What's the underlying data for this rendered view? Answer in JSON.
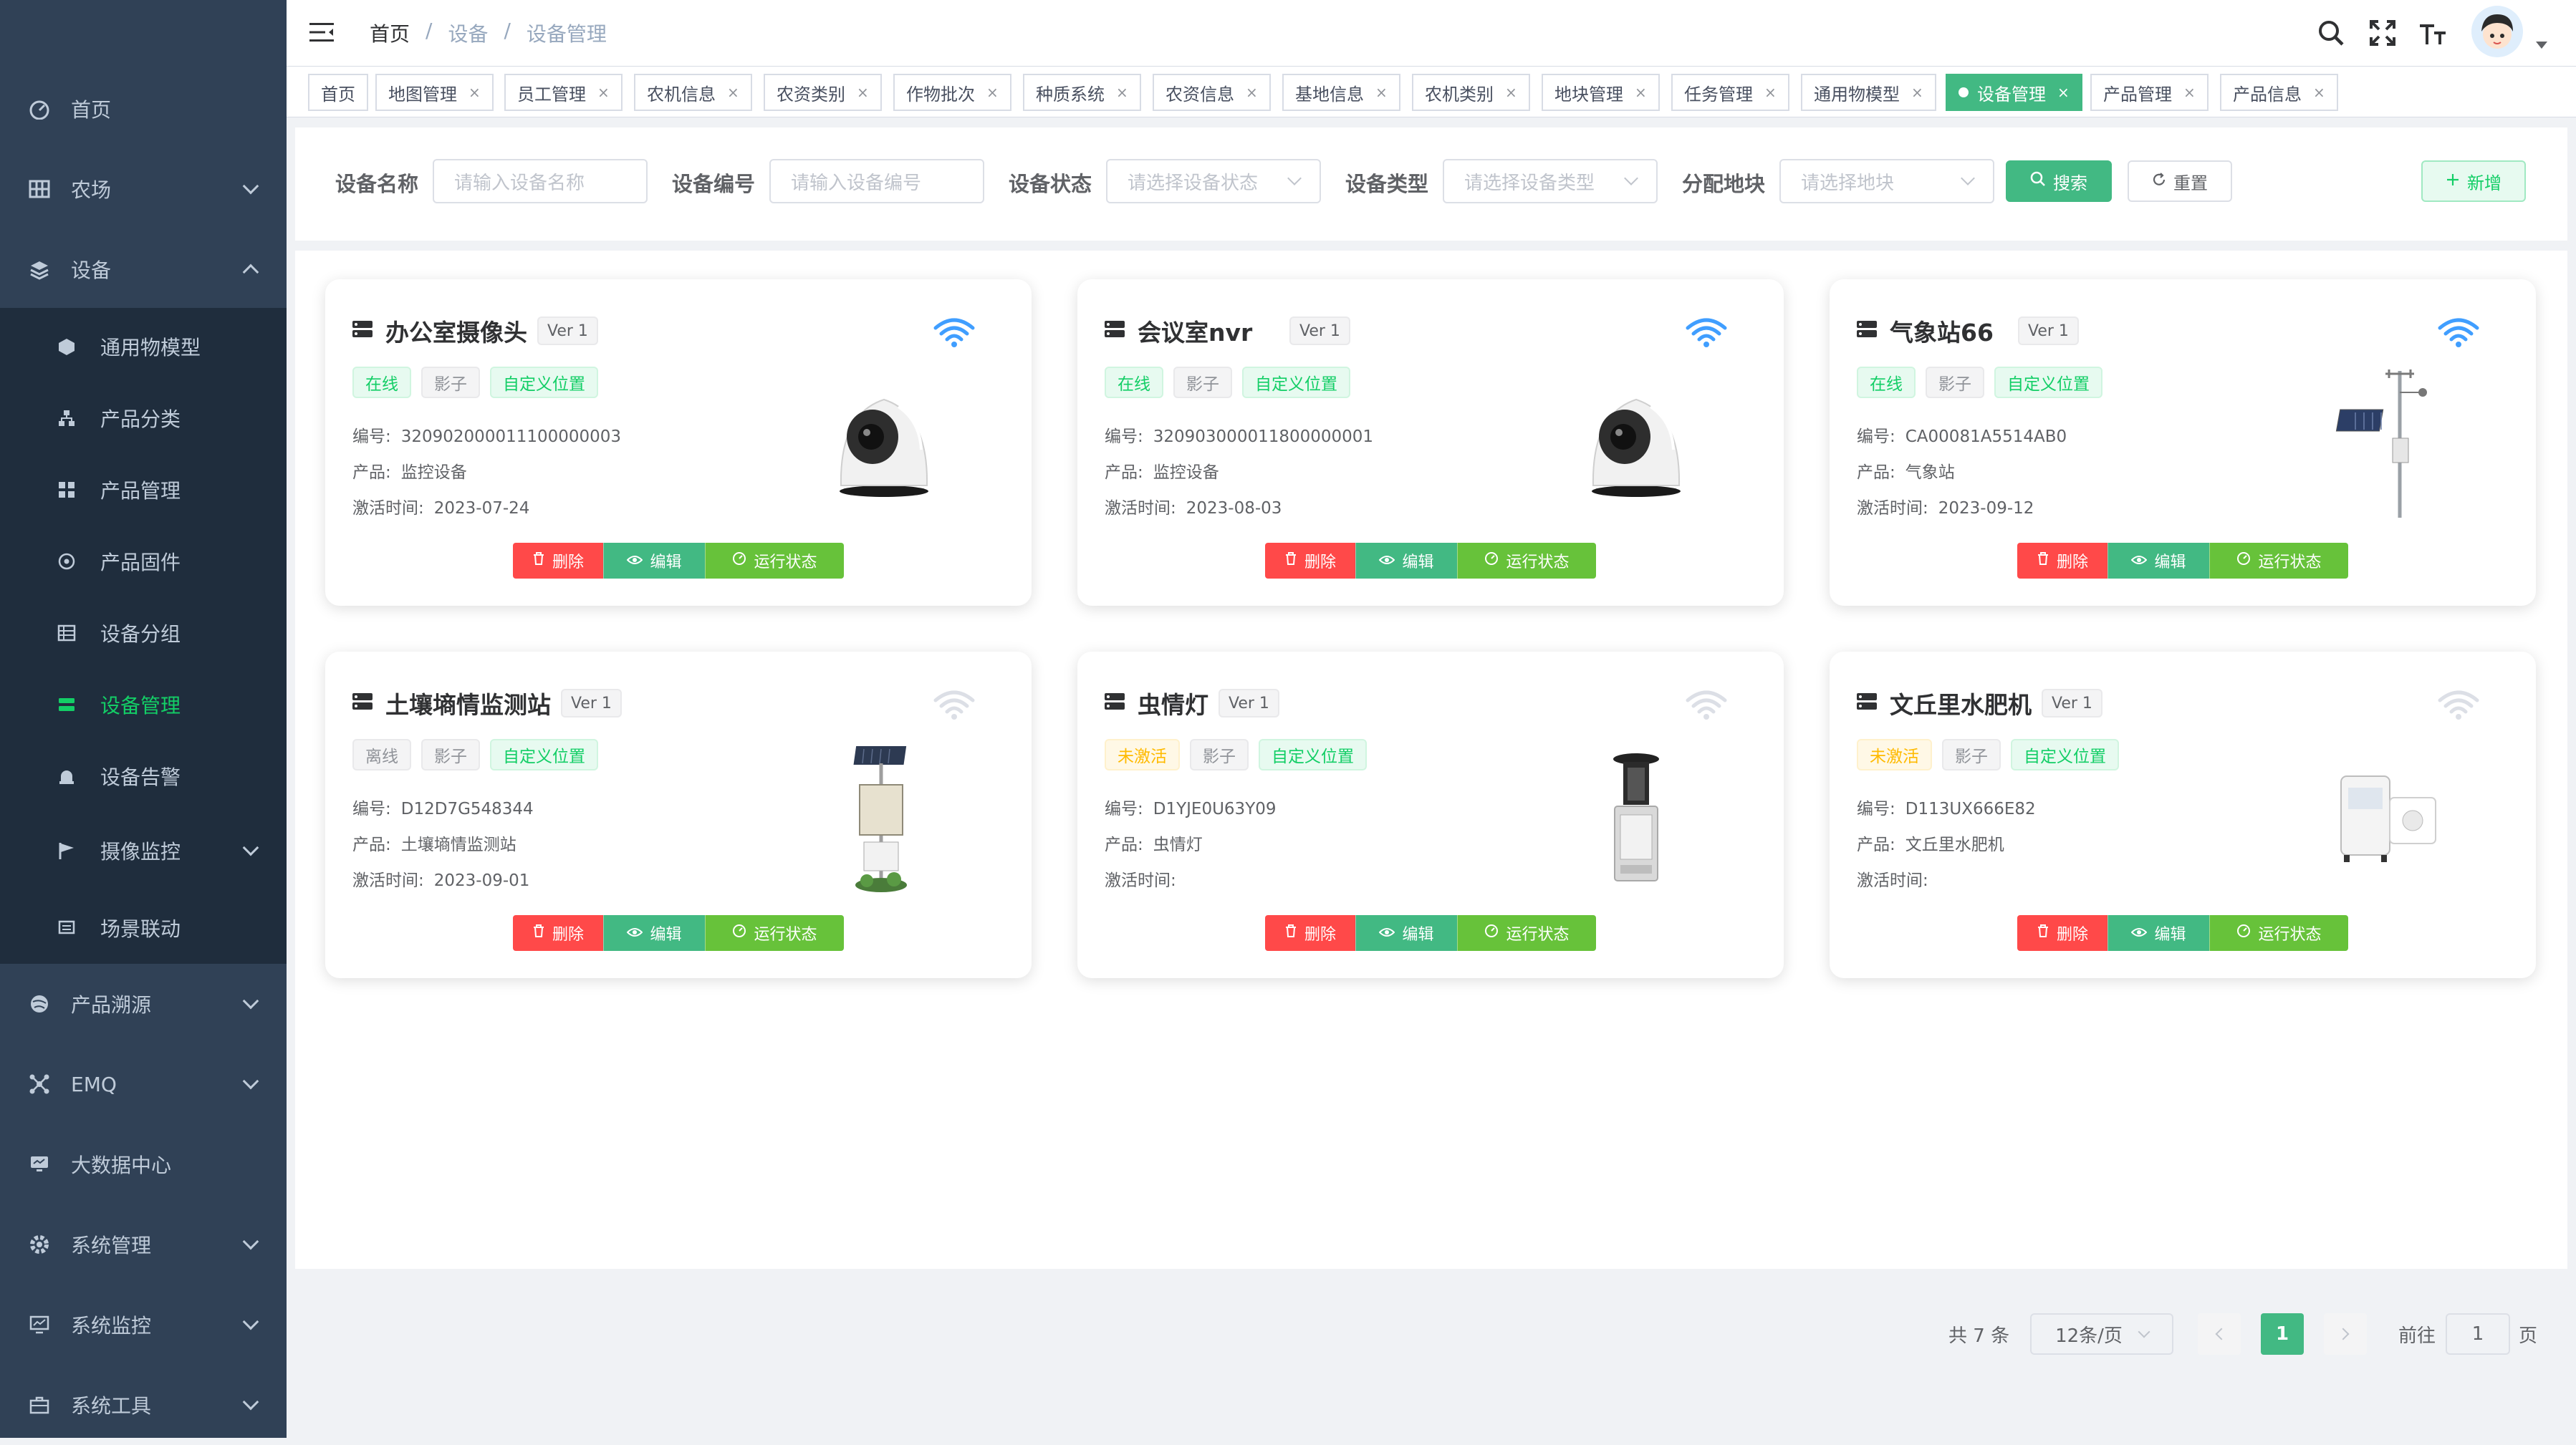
{
  "sidebar": {
    "items": [
      {
        "label": "首页",
        "icon": "dashboard-icon"
      },
      {
        "label": "农场",
        "icon": "grid-icon",
        "expandable": true
      },
      {
        "label": "设备",
        "icon": "layers-icon",
        "expandable": true,
        "expanded": true
      },
      {
        "label": "通用物模型",
        "icon": "cube-icon",
        "sub": true
      },
      {
        "label": "产品分类",
        "icon": "tree-icon",
        "sub": true
      },
      {
        "label": "产品管理",
        "icon": "apps-icon",
        "sub": true
      },
      {
        "label": "产品固件",
        "icon": "target-icon",
        "sub": true
      },
      {
        "label": "设备分组",
        "icon": "list-icon",
        "sub": true
      },
      {
        "label": "设备管理",
        "icon": "server-icon",
        "sub": true,
        "active": true
      },
      {
        "label": "设备告警",
        "icon": "alarm-icon",
        "sub": true
      },
      {
        "label": "摄像监控",
        "icon": "flag-icon",
        "sub": true,
        "expandable": true
      },
      {
        "label": "场景联动",
        "icon": "scene-icon",
        "sub": true
      },
      {
        "label": "产品溯源",
        "icon": "globe-icon",
        "expandable": true
      },
      {
        "label": "EMQ",
        "icon": "network-icon",
        "expandable": true
      },
      {
        "label": "大数据中心",
        "icon": "monitor-icon"
      },
      {
        "label": "系统管理",
        "icon": "settings-icon",
        "expandable": true
      },
      {
        "label": "系统监控",
        "icon": "chart-monitor-icon",
        "expandable": true
      },
      {
        "label": "系统工具",
        "icon": "toolbox-icon",
        "expandable": true
      }
    ]
  },
  "header": {
    "breadcrumb": [
      "首页",
      "设备",
      "设备管理"
    ],
    "separator": "/",
    "icons": [
      "search-icon",
      "fullscreen-icon",
      "font-size-icon"
    ]
  },
  "tags": [
    {
      "label": "首页",
      "closable": false
    },
    {
      "label": "地图管理",
      "closable": true
    },
    {
      "label": "员工管理",
      "closable": true
    },
    {
      "label": "农机信息",
      "closable": true
    },
    {
      "label": "农资类别",
      "closable": true
    },
    {
      "label": "作物批次",
      "closable": true
    },
    {
      "label": "种质系统",
      "closable": true
    },
    {
      "label": "农资信息",
      "closable": true
    },
    {
      "label": "基地信息",
      "closable": true
    },
    {
      "label": "农机类别",
      "closable": true
    },
    {
      "label": "地块管理",
      "closable": true
    },
    {
      "label": "任务管理",
      "closable": true
    },
    {
      "label": "通用物模型",
      "closable": true
    },
    {
      "label": "设备管理",
      "closable": true,
      "active": true
    },
    {
      "label": "产品管理",
      "closable": true
    },
    {
      "label": "产品信息",
      "closable": true
    }
  ],
  "tag_close": "×",
  "search": {
    "fields": [
      {
        "label": "设备名称",
        "placeholder": "请输入设备名称",
        "type": "input"
      },
      {
        "label": "设备编号",
        "placeholder": "请输入设备编号",
        "type": "input"
      },
      {
        "label": "设备状态",
        "placeholder": "请选择设备状态",
        "type": "select"
      },
      {
        "label": "设备类型",
        "placeholder": "请选择设备类型",
        "type": "select"
      },
      {
        "label": "分配地块",
        "placeholder": "请选择地块",
        "type": "select"
      }
    ],
    "search_label": "搜索",
    "reset_label": "重置",
    "add_label": "新增"
  },
  "labels": {
    "code": "编号:",
    "product": "产品:",
    "activated": "激活时间:",
    "shadow": "影子",
    "custom_location": "自定义位置",
    "delete": "删除",
    "edit": "编辑",
    "run_status": "运行状态"
  },
  "devices": [
    {
      "name": "办公室摄像头",
      "version": "Ver 1",
      "status": "在线",
      "status_kind": "online",
      "code": "320902000011100000003",
      "product": "监控设备",
      "activated": "2023-07-24",
      "image": "dome-camera-image",
      "wifi_active": true
    },
    {
      "name": "会议室nvr",
      "version": "Ver 1",
      "status": "在线",
      "status_kind": "online",
      "code": "320903000011800000001",
      "product": "监控设备",
      "activated": "2023-08-03",
      "image": "dome-camera-image",
      "wifi_active": true
    },
    {
      "name": "气象站66",
      "version": "Ver 1",
      "status": "在线",
      "status_kind": "online",
      "code": "CA00081A5514AB0",
      "product": "气象站",
      "activated": "2023-09-12",
      "image": "weather-station-image",
      "wifi_active": true
    },
    {
      "name": "土壤墒情监测站",
      "version": "Ver 1",
      "status": "离线",
      "status_kind": "offline",
      "code": "D12D7G548344",
      "product": "土壤墒情监测站",
      "activated": "2023-09-01",
      "image": "soil-station-image",
      "wifi_active": false
    },
    {
      "name": "虫情灯",
      "version": "Ver 1",
      "status": "未激活",
      "status_kind": "inactive",
      "code": "D1YJE0U63Y09",
      "product": "虫情灯",
      "activated": "",
      "image": "insect-lamp-image",
      "wifi_active": false
    },
    {
      "name": "文丘里水肥机",
      "version": "Ver 1",
      "status": "未激活",
      "status_kind": "inactive",
      "code": "D113UX666E82",
      "product": "文丘里水肥机",
      "activated": "",
      "image": "fertilizer-machine-image",
      "wifi_active": false
    }
  ],
  "pagination": {
    "total": "共 7 条",
    "page_size": "12条/页",
    "current_page": "1",
    "goto_prefix": "前往",
    "goto_value": "1",
    "goto_suffix": "页"
  },
  "colors": {
    "sidebar_bg": "#304156",
    "submenu_bg": "#1f2d3d",
    "accent": "#42b983",
    "danger": "#ff4949",
    "success": "#67c23a",
    "wifi_active": "#409eff",
    "wifi_inactive": "#dcdfe6"
  }
}
